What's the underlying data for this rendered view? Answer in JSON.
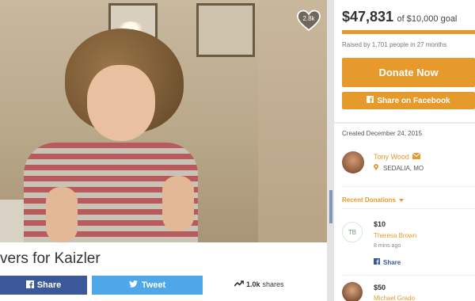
{
  "photo": {
    "heart_count": "2.8k"
  },
  "story": {
    "title": "vers for Kaizler"
  },
  "share_bar": {
    "facebook_label": "Share",
    "twitter_label": "Tweet",
    "shares_count": "1.0k",
    "shares_suffix": "shares"
  },
  "goal": {
    "raised_amount": "$47,831",
    "goal_text": "of $10,000 goal",
    "progress_fraction": 1.0,
    "raised_by_text": "Raised by 1,701 people in 27 months",
    "donate_label": "Donate Now",
    "fb_share_label": "Share on Facebook"
  },
  "organizer": {
    "created_text": "Created December 24, 2015",
    "name": "Tony Wood",
    "location": "SEDALIA, MO"
  },
  "recent_donations": {
    "header": "Recent Donations",
    "items": [
      {
        "initials": "TB",
        "amount": "$10",
        "name": "Theresa Brown",
        "time": "8 mins ago",
        "share_label": "Share"
      },
      {
        "initials": "",
        "amount": "$50",
        "name": "Michael Grado",
        "time": "",
        "share_label": ""
      }
    ]
  },
  "colors": {
    "accent": "#e69a2c",
    "facebook": "#3b5998",
    "twitter": "#4da7e8"
  }
}
